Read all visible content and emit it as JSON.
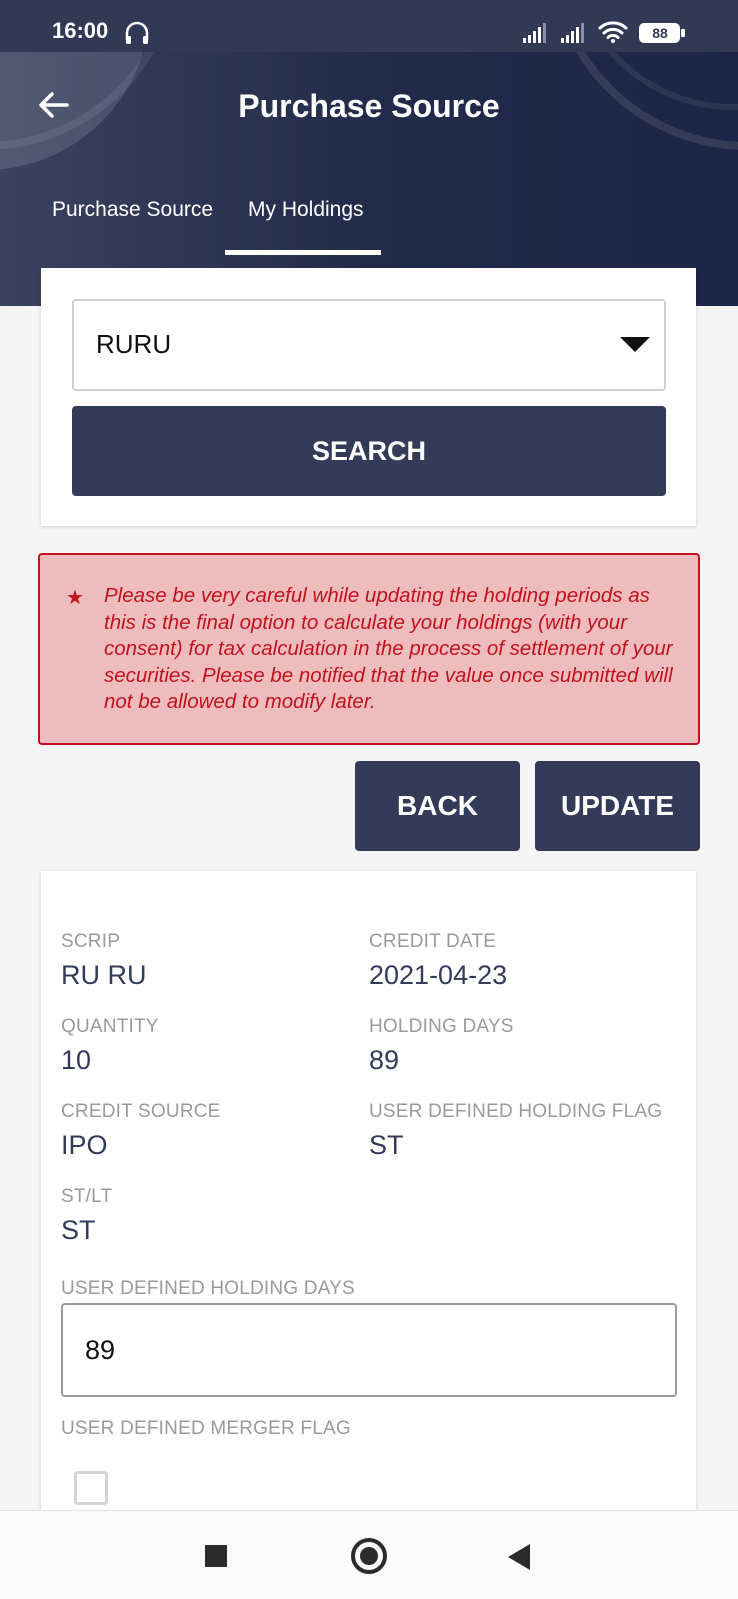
{
  "status_bar": {
    "time": "16:00",
    "battery": "88",
    "icons": [
      "headset-icon",
      "signal-icon",
      "signal-icon",
      "wifi-icon",
      "battery-icon"
    ]
  },
  "header": {
    "title": "Purchase Source",
    "back_icon": "arrow-left-icon",
    "tabs": [
      {
        "label": "Purchase Source",
        "active": false
      },
      {
        "label": "My Holdings",
        "active": true
      }
    ]
  },
  "search": {
    "selected_value": "RURU",
    "button_label": "SEARCH"
  },
  "warning": {
    "icon": "star-icon",
    "text": "Please be very careful while updating the holding periods as this is the final option to calculate your holdings (with your consent) for tax calculation in the process of settlement of your securities. Please be notified that the value once submitted will not be allowed to modify later."
  },
  "actions": {
    "back_label": "BACK",
    "update_label": "UPDATE"
  },
  "details": {
    "scrip_label": "SCRIP",
    "scrip_value": "RU RU",
    "credit_date_label": "CREDIT DATE",
    "credit_date_value": "2021-04-23",
    "quantity_label": "QUANTITY",
    "quantity_value": "10",
    "holding_days_label": "HOLDING DAYS",
    "holding_days_value": "89",
    "credit_source_label": "CREDIT SOURCE",
    "credit_source_value": "IPO",
    "user_flag_label": "USER DEFINED HOLDING FLAG",
    "user_flag_value": "ST",
    "st_lt_label": "ST/LT",
    "st_lt_value": "ST",
    "user_days_label": "USER DEFINED HOLDING DAYS",
    "user_days_value": "89",
    "merger_flag_label": "USER DEFINED MERGER FLAG",
    "merger_flag_checked": false
  },
  "colors": {
    "primary": "#343b58",
    "header_dark": "#1c2547",
    "warning_bg": "#eebcbd",
    "warning_text": "#c1121f"
  }
}
